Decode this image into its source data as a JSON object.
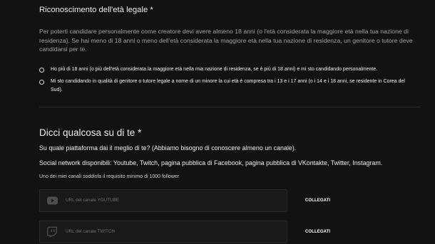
{
  "theme": {
    "background": "#121212",
    "text_primary": "#ececec",
    "text_secondary": "#a0a0a0",
    "field_background": "#191919",
    "field_border": "#2a2a2a",
    "placeholder": "#727272",
    "icon": "#4d4d4d"
  },
  "legal_age": {
    "title": "Riconoscimento dell'età legale *",
    "description": "Per poterti candidare personalmente come creatore devi avere almeno 18 anni (o l'età considerata la maggiore età nella tua nazione di residenza). Se hai meno di 18 anni o meno dell'età considerata la maggiore età nella tua nazione di residenza, un genitore o tutore deve candidarsi per te.",
    "options": [
      {
        "label": "Ho più di 18 anni (o più dell'età considerata la maggiore età nella mia nazione di residenza, se è più di 18 anni) e mi sto candidando personalmente.",
        "selected": false
      },
      {
        "label": "Mi sto candidando in qualità di genitore o tutore legale a nome di un minore la cui età è compresa tra i 13 e i 17 anni (o i 14 e i 18 anni, se residente in Corea del Sud).",
        "selected": false
      }
    ]
  },
  "about": {
    "title": "Dicci qualcosa su di te *",
    "platform_question": "Su quale piattaforma dai il meglio di te? (Abbiamo bisogno di conoscere almeno un canale).",
    "available_networks": "Social network disponibili: Youtube, Twitch, pagina pubblica di Facebook, pagina pubblica di VKontakte, Twitter, Instagram.",
    "follower_requirement": "Uno dei miei canali soddisfa il requisito minimo di 1000 follower"
  },
  "channels": [
    {
      "icon": "youtube-icon",
      "placeholder": "URL del canale YOUTUBE",
      "button_label": "COLLEGATI"
    },
    {
      "icon": "twitch-icon",
      "placeholder": "URL del canale TWITCH",
      "button_label": "COLLEGATI"
    }
  ]
}
